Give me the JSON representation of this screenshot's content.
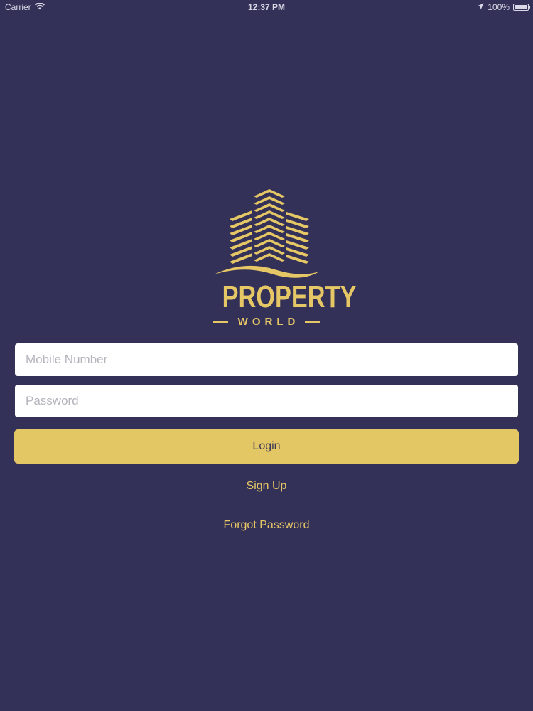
{
  "status_bar": {
    "carrier": "Carrier",
    "time": "12:37 PM",
    "battery_text": "100%",
    "battery_level": 1.0,
    "icons": [
      "wifi-icon",
      "location-arrow-icon",
      "battery-icon"
    ]
  },
  "logo": {
    "brand_word": "PROPERTY",
    "brand_sub": "WORLD",
    "icon": "buildings-logo-icon"
  },
  "form": {
    "mobile_placeholder": "Mobile Number",
    "mobile_value": "",
    "password_placeholder": "Password",
    "password_value": "",
    "login_label": "Login",
    "signup_label": "Sign Up",
    "forgot_label": "Forgot Password"
  },
  "colors": {
    "background": "#343158",
    "accent_gold": "#e3c764",
    "field_bg": "#ffffff",
    "placeholder": "#b4b4bc"
  }
}
